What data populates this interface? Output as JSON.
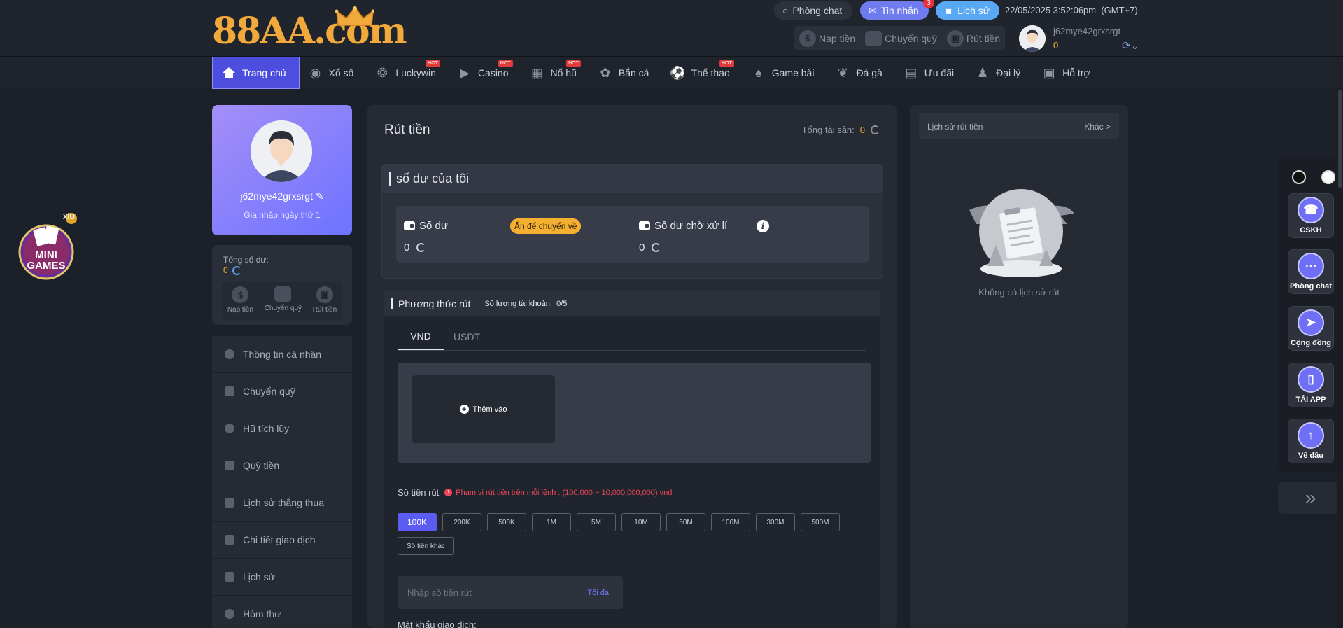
{
  "brand": {
    "logo_text": "88AA.com"
  },
  "header": {
    "chat_label": "Phòng chat",
    "messages_label": "Tin nhắn",
    "messages_badge": "3",
    "history_label": "Lịch sử",
    "datetime": "22/05/2025 3:52:06pm",
    "timezone": "(GMT+7)",
    "actions": [
      {
        "label": "Nạp tiền",
        "icon": "deposit-icon"
      },
      {
        "label": "Chuyển quỹ",
        "icon": "wallet-icon"
      },
      {
        "label": "Rút tiền",
        "icon": "withdraw-icon"
      }
    ],
    "username": "j62mye42grxsrgt",
    "balance": "0"
  },
  "nav": {
    "items": [
      {
        "label": "Trang chủ",
        "icon": "home-icon",
        "hot": false,
        "active": true
      },
      {
        "label": "Xổ số",
        "icon": "lottery-icon",
        "hot": false
      },
      {
        "label": "Luckywin",
        "icon": "luckywin-icon",
        "hot": true
      },
      {
        "label": "Casino",
        "icon": "casino-icon",
        "hot": true
      },
      {
        "label": "Nổ hũ",
        "icon": "slot-icon",
        "hot": true
      },
      {
        "label": "Bắn cá",
        "icon": "fish-icon",
        "hot": false
      },
      {
        "label": "Thể thao",
        "icon": "sport-icon",
        "hot": true
      },
      {
        "label": "Game bài",
        "icon": "cards-icon",
        "hot": false
      },
      {
        "label": "Đá gà",
        "icon": "rooster-icon",
        "hot": false
      },
      {
        "label": "Ưu đãi",
        "icon": "promo-icon",
        "hot": false
      },
      {
        "label": "Đại lý",
        "icon": "agent-icon",
        "hot": false
      },
      {
        "label": "Hỗ trợ",
        "icon": "support-icon",
        "hot": false
      }
    ],
    "hot_label": "HOT"
  },
  "profile": {
    "username": "j62mye42grxsrgt",
    "joined": "Gia nhập ngày thứ 1"
  },
  "wallet": {
    "title": "Tổng số dư:",
    "balance": "0",
    "actions": [
      {
        "label": "Nạp tiền"
      },
      {
        "label": "Chuyển quỹ"
      },
      {
        "label": "Rút tiền"
      }
    ]
  },
  "sidebar": {
    "items": [
      {
        "label": "Thông tin cá nhân"
      },
      {
        "label": "Chuyển quỹ"
      },
      {
        "label": "Hũ tích lũy"
      },
      {
        "label": "Quỹ tiền"
      },
      {
        "label": "Lịch sử thắng thua"
      },
      {
        "label": "Chi tiết giao dịch"
      },
      {
        "label": "Lịch sử"
      },
      {
        "label": "Hòm thư"
      }
    ]
  },
  "main": {
    "title": "Rút tiền",
    "total_label": "Tổng tài sản:",
    "total_value": "0",
    "balance_section": {
      "title": "số dư của tôi",
      "balance_label": "Số dư",
      "balance_value": "0",
      "transfer_back": "Ấn để chuyển về",
      "pending_label": "Số dư chờ xử lí",
      "pending_value": "0"
    },
    "payment": {
      "title": "Phương thức rút",
      "count_label": "Số lượng tài khoản:",
      "count_value": "0/5",
      "tabs": [
        "VND",
        "USDT"
      ],
      "add_label": "Thêm vào"
    },
    "amount": {
      "label": "Số tiền rút",
      "range": "Phạm vi rút tiền trên mỗi lệnh : (100,000 ~ 10,000,000,000) vnd",
      "chips": [
        "100K",
        "200K",
        "500K",
        "1M",
        "5M",
        "10M",
        "50M",
        "100M",
        "300M",
        "500M",
        "Số tiền khác"
      ],
      "placeholder": "Nhập số tiền rút",
      "max_label": "Tối đa",
      "password_label": "Mật khẩu giao dịch:"
    }
  },
  "history_panel": {
    "title": "Lịch sử rút tiền",
    "more": "Khác >",
    "empty": "Không có lịch sử rút"
  },
  "mini_games": {
    "label": "MINI GAMES",
    "tag": "XỈU"
  },
  "float": {
    "buttons": [
      {
        "label": "CSKH",
        "icon": "headset-icon"
      },
      {
        "label": "Phòng chat",
        "icon": "chat-bubble-icon"
      },
      {
        "label": "Cộng đồng",
        "icon": "send-icon"
      },
      {
        "label": "TẢI APP",
        "icon": "phone-icon"
      },
      {
        "label": "Về đầu",
        "icon": "arrow-up-icon"
      }
    ]
  }
}
